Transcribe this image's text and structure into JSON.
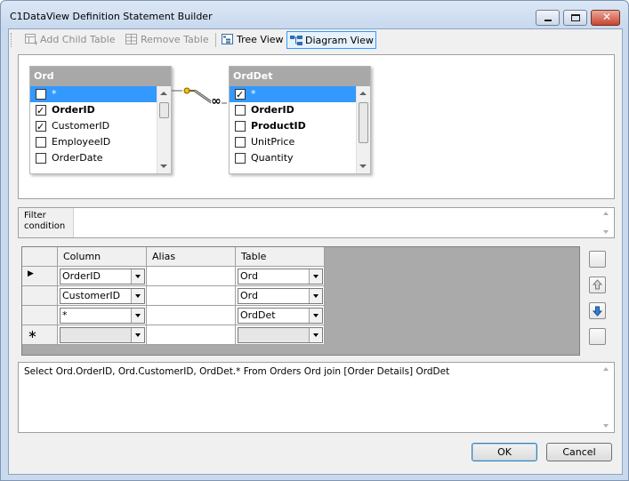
{
  "window": {
    "title": "C1DataView Definition Statement Builder"
  },
  "toolbar": {
    "add_child_table": "Add Child Table",
    "remove_table": "Remove Table",
    "tree_view": "Tree View",
    "diagram_view": "Diagram View"
  },
  "diagram": {
    "tables": [
      {
        "name": "Ord",
        "rows": [
          {
            "label": "*",
            "checked": false,
            "bold": false,
            "selected": true
          },
          {
            "label": "OrderID",
            "checked": true,
            "bold": true,
            "selected": false
          },
          {
            "label": "CustomerID",
            "checked": true,
            "bold": false,
            "selected": false
          },
          {
            "label": "EmployeeID",
            "checked": false,
            "bold": false,
            "selected": false
          },
          {
            "label": "OrderDate",
            "checked": false,
            "bold": false,
            "selected": false
          }
        ]
      },
      {
        "name": "OrdDet",
        "rows": [
          {
            "label": "*",
            "checked": true,
            "bold": false,
            "selected": true
          },
          {
            "label": "OrderID",
            "checked": false,
            "bold": true,
            "selected": false
          },
          {
            "label": "ProductID",
            "checked": false,
            "bold": true,
            "selected": false
          },
          {
            "label": "UnitPrice",
            "checked": false,
            "bold": false,
            "selected": false
          },
          {
            "label": "Quantity",
            "checked": false,
            "bold": false,
            "selected": false
          }
        ]
      }
    ],
    "relation_symbol": "∞"
  },
  "filter": {
    "label": "Filter condition",
    "value": ""
  },
  "grid": {
    "headers": [
      "Column",
      "Alias",
      "Table"
    ],
    "rows": [
      {
        "column": "OrderID",
        "alias": "",
        "table": "Ord",
        "current": true
      },
      {
        "column": "CustomerID",
        "alias": "",
        "table": "Ord",
        "current": false
      },
      {
        "column": "*",
        "alias": "",
        "table": "OrdDet",
        "current": false
      },
      {
        "column": "",
        "alias": "",
        "table": "",
        "new_row": true
      }
    ],
    "new_row_marker": "∗",
    "current_row_marker": "▶"
  },
  "sql": {
    "text": "Select Ord.OrderID, Ord.CustomerID, OrdDet.* From Orders Ord join [Order Details] OrdDet"
  },
  "buttons": {
    "ok": "OK",
    "cancel": "Cancel"
  },
  "colors": {
    "selection": "#3399ff",
    "table_header": "#a8a8a8",
    "grid_background": "#aaaaaa",
    "title_bar": "#c9d9ee"
  }
}
